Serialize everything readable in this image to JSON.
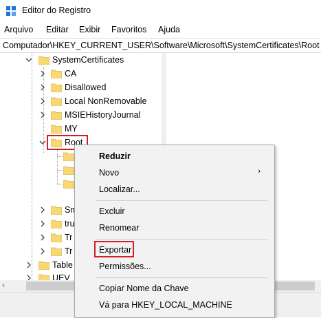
{
  "window": {
    "title": "Editor do Registro"
  },
  "menubar": {
    "items": [
      "Arquivo",
      "Editar",
      "Exibir",
      "Favoritos",
      "Ajuda"
    ]
  },
  "address": {
    "path": "Computador\\HKEY_CURRENT_USER\\Software\\Microsoft\\SystemCertificates\\Root"
  },
  "tree": {
    "system_certificates": "SystemCertificates",
    "ca": "CA",
    "disallowed": "Disallowed",
    "local_nonremovable": "Local NonRemovable",
    "msie_history": "MSIEHistoryJournal",
    "my": "MY",
    "root": "Root",
    "sm": "Sm",
    "tru": "tru",
    "tr1": "Tr",
    "tr2": "Tr",
    "table": "Table",
    "uev": "UEV"
  },
  "context_menu": {
    "collapse": "Reduzir",
    "new": "Novo",
    "find": "Localizar...",
    "delete": "Excluir",
    "rename": "Renomear",
    "export": "Exportar",
    "permissions": "Permissões...",
    "copy_key_name": "Copiar Nome da Chave",
    "goto": "Vá para HKEY_LOCAL_MACHINE"
  },
  "colors": {
    "folder": "#f8d775",
    "highlight": "#d11f26",
    "icon_blue": "#1e73d8"
  }
}
